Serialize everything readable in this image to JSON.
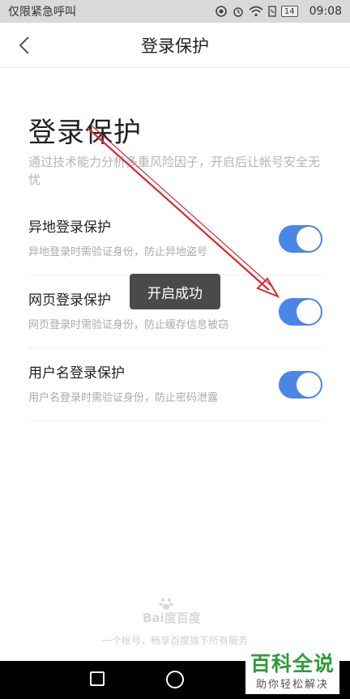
{
  "status_bar": {
    "carrier": "仅限紧急呼叫",
    "battery": "14",
    "time": "09:08"
  },
  "header": {
    "title": "登录保护",
    "back_icon": "chevron-left-icon"
  },
  "main": {
    "title": "登录保护",
    "subtitle": "通过技术能力分析多重风险因子，开启后让帐号安全无忧",
    "settings": [
      {
        "label": "异地登录保护",
        "desc": "异地登录时需验证身份，防止异地盗号",
        "enabled": true
      },
      {
        "label": "网页登录保护",
        "desc": "网页登录时需验证身份，防止缓存信息被窃",
        "enabled": true
      },
      {
        "label": "用户名登录保护",
        "desc": "用户名登录时需验证身份，防止密码泄露",
        "enabled": true
      }
    ]
  },
  "toast": {
    "text": "开启成功"
  },
  "footer": {
    "logo": "Bai度百度",
    "text": "一个帐号，畅享百度旗下所有服务"
  },
  "watermark": {
    "main": "百科全说",
    "sub": "助你轻松解决"
  },
  "colors": {
    "accent": "#4a86e8",
    "arrow": "#d62b2b",
    "toast_bg": "#4a4a4a",
    "watermark_green": "#2e9c3a"
  }
}
